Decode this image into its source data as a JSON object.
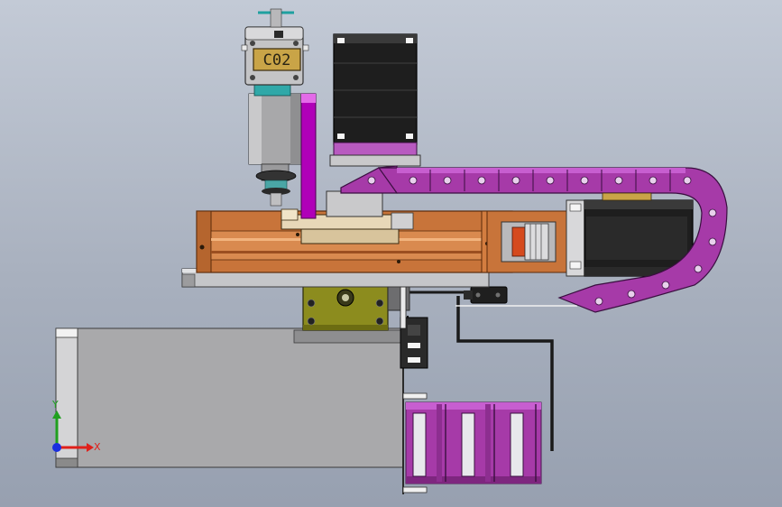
{
  "model": {
    "part_label": "C02"
  },
  "triad": {
    "x_label": "X",
    "y_label": "Y",
    "x_color": "#e0201a",
    "y_color": "#1fa01f",
    "z_color": "#1a2ee0"
  },
  "colors": {
    "background": "#a8b0be",
    "drag_chain": "#a63aa8",
    "drag_chain_light": "#c75ed0",
    "slide_rail": "#c8743a",
    "motor_body": "#1e1e1e",
    "tower_housing": "#a8a8aa",
    "mount_block": "#8c8c1e",
    "accent_magenta": "#b000b8"
  }
}
